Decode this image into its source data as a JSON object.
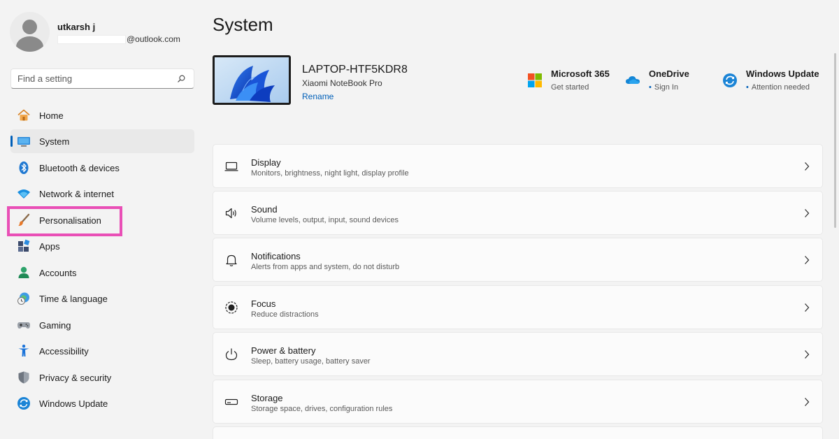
{
  "profile": {
    "name": "utkarsh j",
    "email_domain": "@outlook.com"
  },
  "search": {
    "placeholder": "Find a setting"
  },
  "sidebar": {
    "items": [
      {
        "label": "Home",
        "icon": "home-icon"
      },
      {
        "label": "System",
        "icon": "system-icon",
        "selected": true
      },
      {
        "label": "Bluetooth & devices",
        "icon": "bluetooth-icon"
      },
      {
        "label": "Network & internet",
        "icon": "wifi-icon"
      },
      {
        "label": "Personalisation",
        "icon": "paintbrush-icon",
        "highlighted": true
      },
      {
        "label": "Apps",
        "icon": "apps-icon"
      },
      {
        "label": "Accounts",
        "icon": "accounts-icon"
      },
      {
        "label": "Time & language",
        "icon": "clock-globe-icon"
      },
      {
        "label": "Gaming",
        "icon": "gamepad-icon"
      },
      {
        "label": "Accessibility",
        "icon": "accessibility-icon"
      },
      {
        "label": "Privacy & security",
        "icon": "shield-icon"
      },
      {
        "label": "Windows Update",
        "icon": "sync-icon"
      }
    ]
  },
  "main": {
    "title": "System",
    "device": {
      "name": "LAPTOP-HTF5KDR8",
      "model": "Xiaomi NoteBook Pro",
      "rename_label": "Rename"
    },
    "quick_links": [
      {
        "title": "Microsoft 365",
        "subtitle": "Get started",
        "icon": "microsoft-logo-icon",
        "dot": false
      },
      {
        "title": "OneDrive",
        "subtitle": "Sign In",
        "icon": "onedrive-icon",
        "dot": true
      },
      {
        "title": "Windows Update",
        "subtitle": "Attention needed",
        "icon": "windows-update-icon",
        "dot": true
      }
    ],
    "cards": [
      {
        "title": "Display",
        "subtitle": "Monitors, brightness, night light, display profile",
        "icon": "display-icon"
      },
      {
        "title": "Sound",
        "subtitle": "Volume levels, output, input, sound devices",
        "icon": "speaker-icon"
      },
      {
        "title": "Notifications",
        "subtitle": "Alerts from apps and system, do not disturb",
        "icon": "bell-icon"
      },
      {
        "title": "Focus",
        "subtitle": "Reduce distractions",
        "icon": "focus-icon"
      },
      {
        "title": "Power & battery",
        "subtitle": "Sleep, battery usage, battery saver",
        "icon": "power-icon"
      },
      {
        "title": "Storage",
        "subtitle": "Storage space, drives, configuration rules",
        "icon": "storage-icon"
      }
    ]
  },
  "colors": {
    "accent": "#005fb8",
    "highlight": "#e94fb6",
    "background": "#f3f3f3",
    "card": "#fbfbfb"
  }
}
